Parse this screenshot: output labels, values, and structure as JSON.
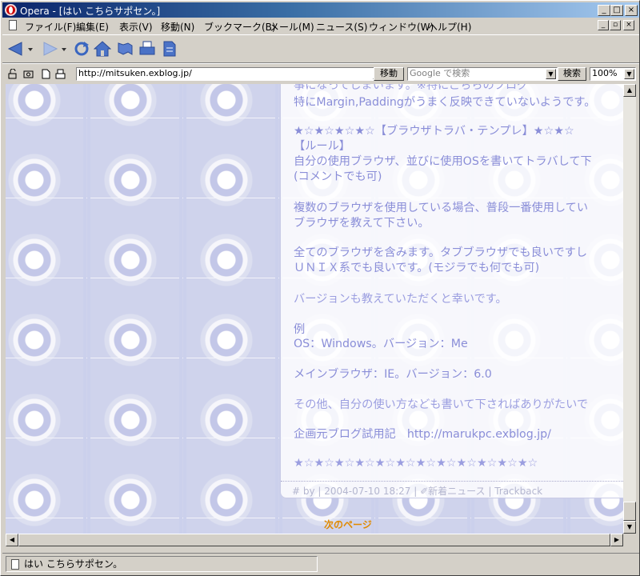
{
  "window": {
    "title": "Opera - [はい こちらサポセン。]",
    "minimize": "_",
    "maximize": "□",
    "close": "×"
  },
  "menu": {
    "items": [
      "ファイル(F)",
      "編集(E)",
      "表示(V)",
      "移動(N)",
      "ブックマーク(B)",
      "メール(M)",
      "ニュース(S)",
      "ウィンドウ(W)",
      "ヘルプ(H)"
    ],
    "mdi_minimize": "_",
    "mdi_restore": "▫",
    "mdi_close": "×"
  },
  "toolbar": {
    "icons": [
      "back-arrow-icon",
      "forward-arrow-icon",
      "reload-icon",
      "home-icon",
      "hotlist-icon",
      "print-icon",
      "new-page-icon"
    ]
  },
  "address": {
    "url": "http://mitsuken.exblog.jp/",
    "go_label": "移動",
    "search_placeholder": "Google で検索",
    "search_label": "検索",
    "zoom": "100%"
  },
  "page": {
    "lines": [
      "特にMargin,Paddingがうまく反映できていないようです。",
      "★☆★☆★☆★☆【ブラウザトラバ・テンプレ】★☆★☆",
      "【ルール】",
      "自分の使用ブラウザ、並びに使用OSを書いてトラバして下",
      "(コメントでも可)",
      "複数のブラウザを使用している場合、普段一番使用してい",
      "ブラウザを教えて下さい。",
      "全てのブラウザを含みます。タブブラウザでも良いですし",
      "ＵＮＩＸ系でも良いです。(モジラでも何でも可)",
      "バージョンも教えていただくと幸いです。",
      "例",
      "OS：Windows。バージョン：Me",
      "メインブラウザ：IE。バージョン：6.0",
      "その他、自分の使い方なども書いて下さればありがたいで",
      "企画元ブログ試用記　http://marukpc.exblog.jp/",
      "★☆★☆★☆★☆★☆★☆★☆★☆★☆★☆★☆★☆"
    ],
    "partial_top_line": "事になってしまいます。※特にこちらのブログ",
    "meta": "# by | 2004-07-10 18:27 | ✐新着ニュース | Trackback",
    "next_page": "次のページ"
  },
  "status": {
    "text": "はい こちらサポセン。"
  }
}
